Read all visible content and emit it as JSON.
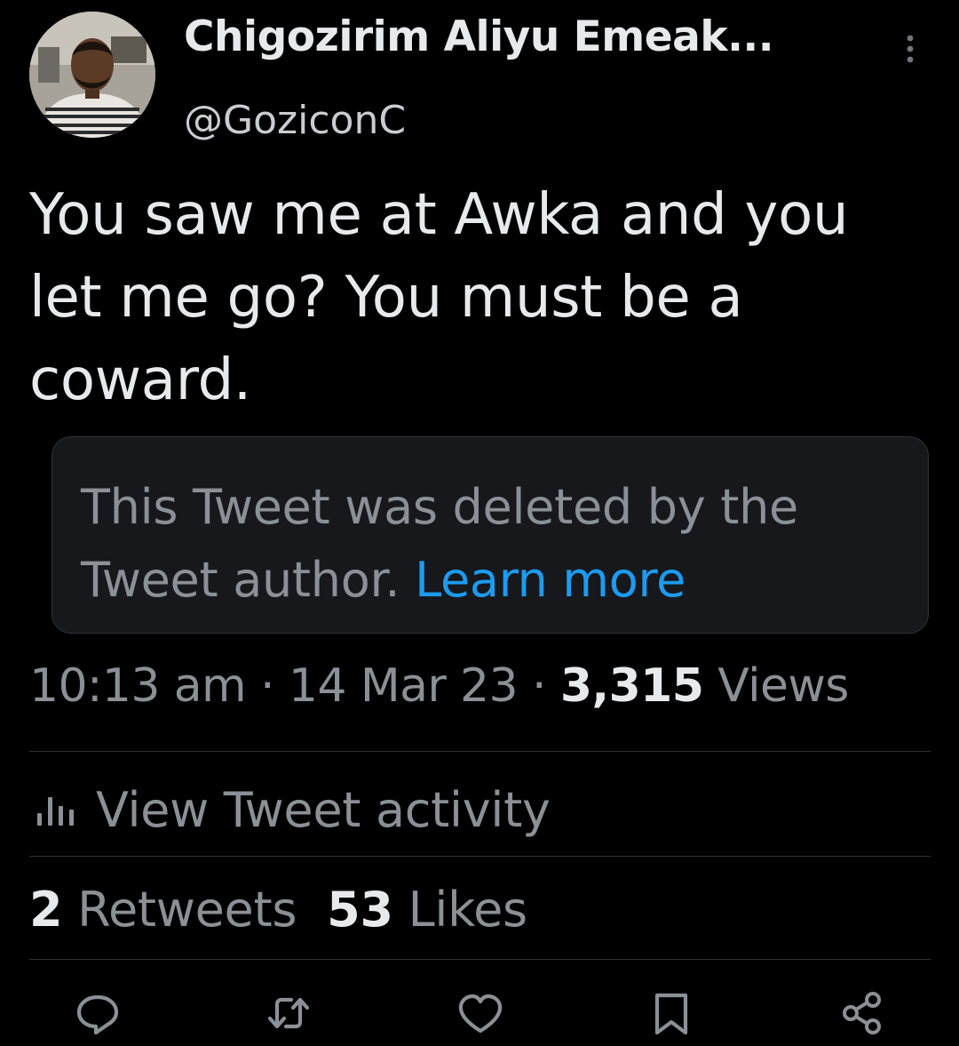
{
  "author": {
    "display_name": "Chigozirim Aliyu Emeak...",
    "handle": "@GoziconC",
    "avatar_icon": "user-avatar"
  },
  "tweet": {
    "text": "You saw me at Awka and you let me go? You must be a coward."
  },
  "quoted": {
    "deleted_message": "This Tweet was deleted by the Tweet author.",
    "learn_more_label": "Learn more"
  },
  "meta": {
    "time": "10:13 am",
    "separator": "·",
    "date": "14 Mar 23",
    "views_count": "3,315",
    "views_label": "Views"
  },
  "activity": {
    "icon": "bar-chart-icon",
    "label": "View Tweet activity"
  },
  "stats": {
    "retweets_count": "2",
    "retweets_label": "Retweets",
    "likes_count": "53",
    "likes_label": "Likes"
  },
  "actions": [
    "reply-icon",
    "retweet-icon",
    "like-icon",
    "bookmark-icon",
    "share-icon"
  ],
  "colors": {
    "background": "#000000",
    "primary_text": "#e7e9ea",
    "secondary_text": "#8a9096",
    "link": "#1d9bf0",
    "divider": "#2f3336",
    "card_bg": "#16181c"
  }
}
